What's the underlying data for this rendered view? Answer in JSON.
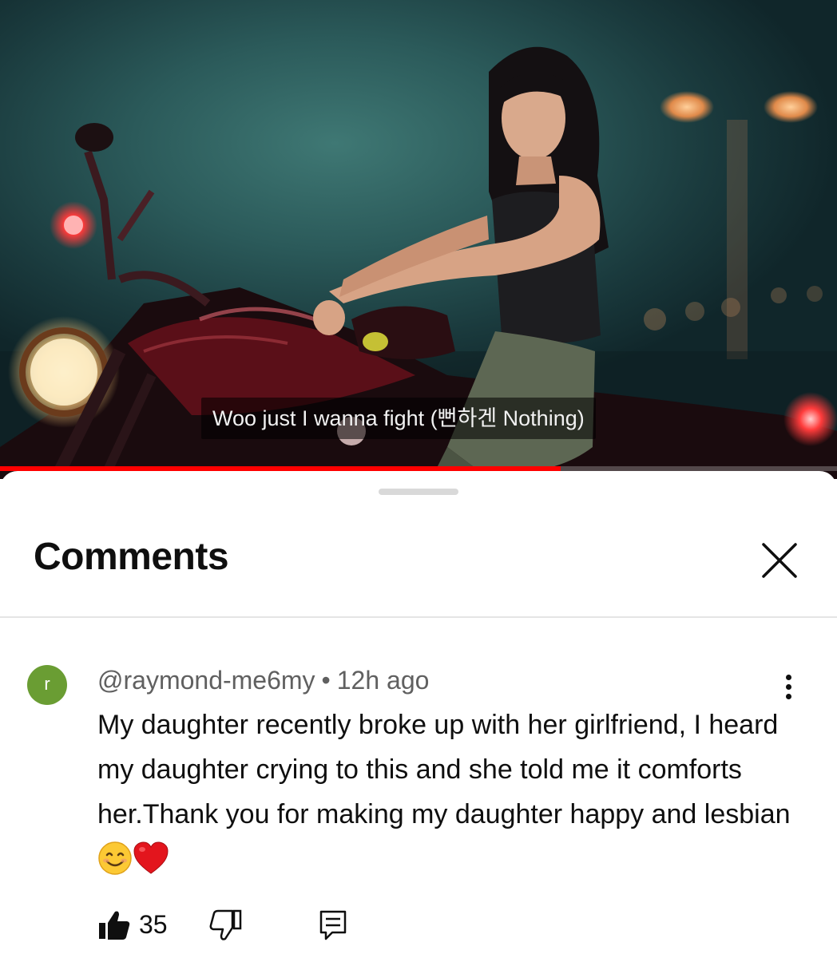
{
  "video": {
    "subtitle": "Woo just I wanna fight (뻔하겐 Nothing)",
    "progress": 0.67,
    "progress_color": "#ff0000"
  },
  "comments_panel": {
    "title": "Comments",
    "close_icon": "close-icon"
  },
  "comment": {
    "avatar_letter": "r",
    "avatar_color": "#6a9d33",
    "author": "@raymond-me6my",
    "separator": "•",
    "time": "12h ago",
    "text": "My daughter recently broke up with her girlfriend, I heard my daughter crying to this and she told me it comforts her.Thank you for making my daughter happy and lesbian",
    "emojis": [
      "smiling-face-emoji",
      "red-heart-emoji"
    ],
    "like_count": "35",
    "icons": [
      "like-icon",
      "dislike-icon",
      "reply-icon",
      "more-vert-icon"
    ]
  }
}
